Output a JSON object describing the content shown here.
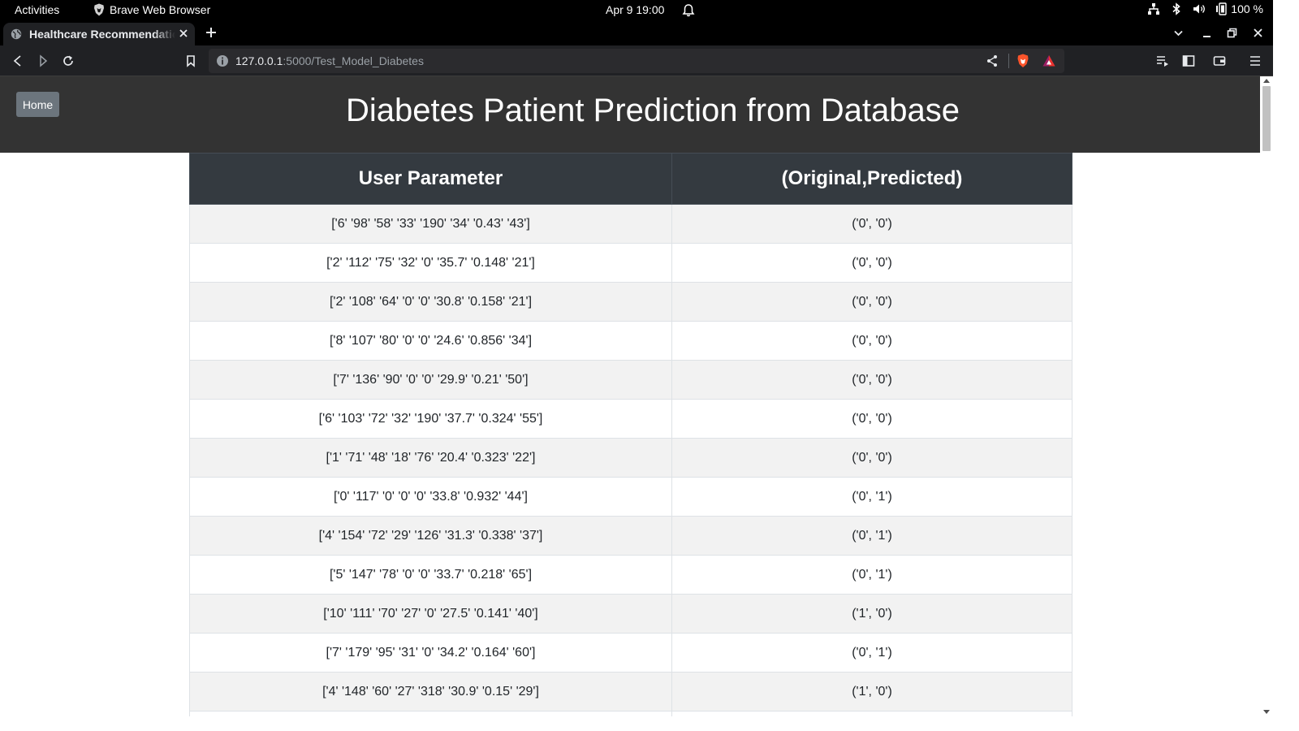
{
  "system_bar": {
    "activities": "Activities",
    "app_name": "Brave Web Browser",
    "clock": "Apr 9  19:00",
    "battery": "100 %"
  },
  "browser": {
    "tab_title": "Healthcare Recommendation System",
    "url_host": "127.0.0.1",
    "url_rest": ":5000/Test_Model_Diabetes"
  },
  "page": {
    "home_button": "Home",
    "title": "Diabetes Patient Prediction from Database",
    "table": {
      "headers": [
        "User Parameter",
        "(Original,Predicted)"
      ],
      "rows": [
        [
          "['6' '98' '58' '33' '190' '34' '0.43' '43']",
          "('0', '0')"
        ],
        [
          "['2' '112' '75' '32' '0' '35.7' '0.148' '21']",
          "('0', '0')"
        ],
        [
          "['2' '108' '64' '0' '0' '30.8' '0.158' '21']",
          "('0', '0')"
        ],
        [
          "['8' '107' '80' '0' '0' '24.6' '0.856' '34']",
          "('0', '0')"
        ],
        [
          "['7' '136' '90' '0' '0' '29.9' '0.21' '50']",
          "('0', '0')"
        ],
        [
          "['6' '103' '72' '32' '190' '37.7' '0.324' '55']",
          "('0', '0')"
        ],
        [
          "['1' '71' '48' '18' '76' '20.4' '0.323' '22']",
          "('0', '0')"
        ],
        [
          "['0' '117' '0' '0' '0' '33.8' '0.932' '44']",
          "('0', '1')"
        ],
        [
          "['4' '154' '72' '29' '126' '31.3' '0.338' '37']",
          "('0', '1')"
        ],
        [
          "['5' '147' '78' '0' '0' '33.7' '0.218' '65']",
          "('0', '1')"
        ],
        [
          "['10' '111' '70' '27' '0' '27.5' '0.141' '40']",
          "('1', '0')"
        ],
        [
          "['7' '179' '95' '31' '0' '34.2' '0.164' '60']",
          "('0', '1')"
        ],
        [
          "['4' '148' '60' '27' '318' '30.9' '0.15' '29']",
          "('1', '0')"
        ]
      ]
    }
  }
}
